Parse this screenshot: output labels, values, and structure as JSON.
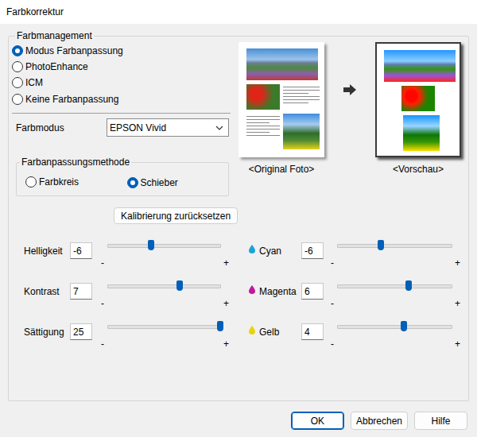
{
  "window": {
    "title": "Farbkorrektur"
  },
  "color_management": {
    "title": "Farbmanagement",
    "options": [
      {
        "label": "Modus Farbanpassung",
        "selected": true
      },
      {
        "label": "PhotoEnhance",
        "selected": false
      },
      {
        "label": "ICM",
        "selected": false
      },
      {
        "label": "Keine Farbanpassung",
        "selected": false
      }
    ]
  },
  "color_mode": {
    "label": "Farbmodus",
    "value": "EPSON Vivid"
  },
  "previews": [
    {
      "caption": "<Original Foto>",
      "kind": "original"
    },
    {
      "caption": "<Vorschau>",
      "kind": "preview"
    }
  ],
  "method": {
    "title": "Farbanpassungsmethode",
    "options": [
      {
        "label": "Farbkreis",
        "selected": false
      },
      {
        "label": "Schieber",
        "selected": true
      }
    ]
  },
  "reset_button": "Kalibrierung zurücksetzen",
  "scale": {
    "minus": "-",
    "plus": "+"
  },
  "sliders_left": [
    {
      "label": "Helligkeit",
      "value": "-6",
      "level": 0.38
    },
    {
      "label": "Kontrast",
      "value": "7",
      "level": 0.64
    },
    {
      "label": "Sättigung",
      "value": "25",
      "level": 1.0
    }
  ],
  "sliders_right": [
    {
      "label": "Cyan",
      "value": "-6",
      "level": 0.38,
      "color": "#1aa3d9"
    },
    {
      "label": "Magenta",
      "value": "6",
      "level": 0.62,
      "color": "#c2189b"
    },
    {
      "label": "Gelb",
      "value": "4",
      "level": 0.58,
      "color": "#e8d40c"
    }
  ],
  "buttons": [
    {
      "label": "OK",
      "default": true
    },
    {
      "label": "Abbrechen",
      "default": false
    },
    {
      "label": "Hilfe",
      "default": false
    }
  ]
}
